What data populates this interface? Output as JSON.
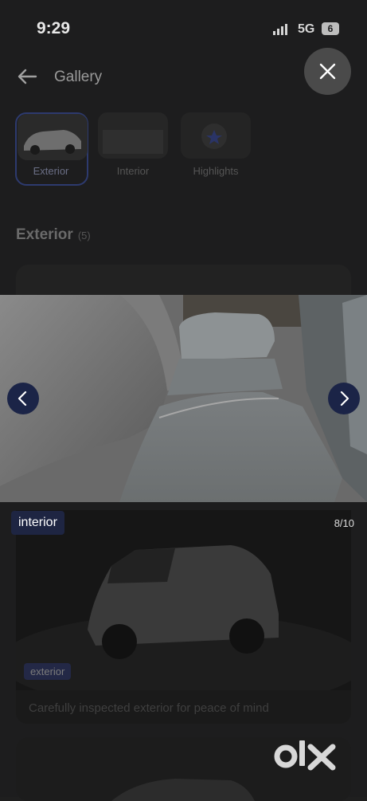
{
  "status_bar": {
    "time": "9:29",
    "network": "5G",
    "battery": "6"
  },
  "header": {
    "title": "Gallery"
  },
  "tabs": [
    {
      "label": "Exterior",
      "selected": true
    },
    {
      "label": "Interior",
      "selected": false
    },
    {
      "label": "Highlights",
      "selected": false
    }
  ],
  "section": {
    "title": "Exterior",
    "count": "(5)"
  },
  "gallery_cards": [
    {
      "tag": "exterior",
      "caption": "Carefully inspected exterior for peace of mind"
    }
  ],
  "viewer": {
    "category": "interior",
    "counter": "8/10",
    "current_index": 8,
    "total": 10
  },
  "brand": {
    "logo_text": "OLX"
  },
  "colors": {
    "nav_button": "#1b2447",
    "badge_bg": "#1e2542",
    "background": "#1d1d1e"
  },
  "icons": {
    "back": "arrow-left-icon",
    "close": "close-icon",
    "prev": "chevron-left-icon",
    "next": "chevron-right-icon"
  }
}
